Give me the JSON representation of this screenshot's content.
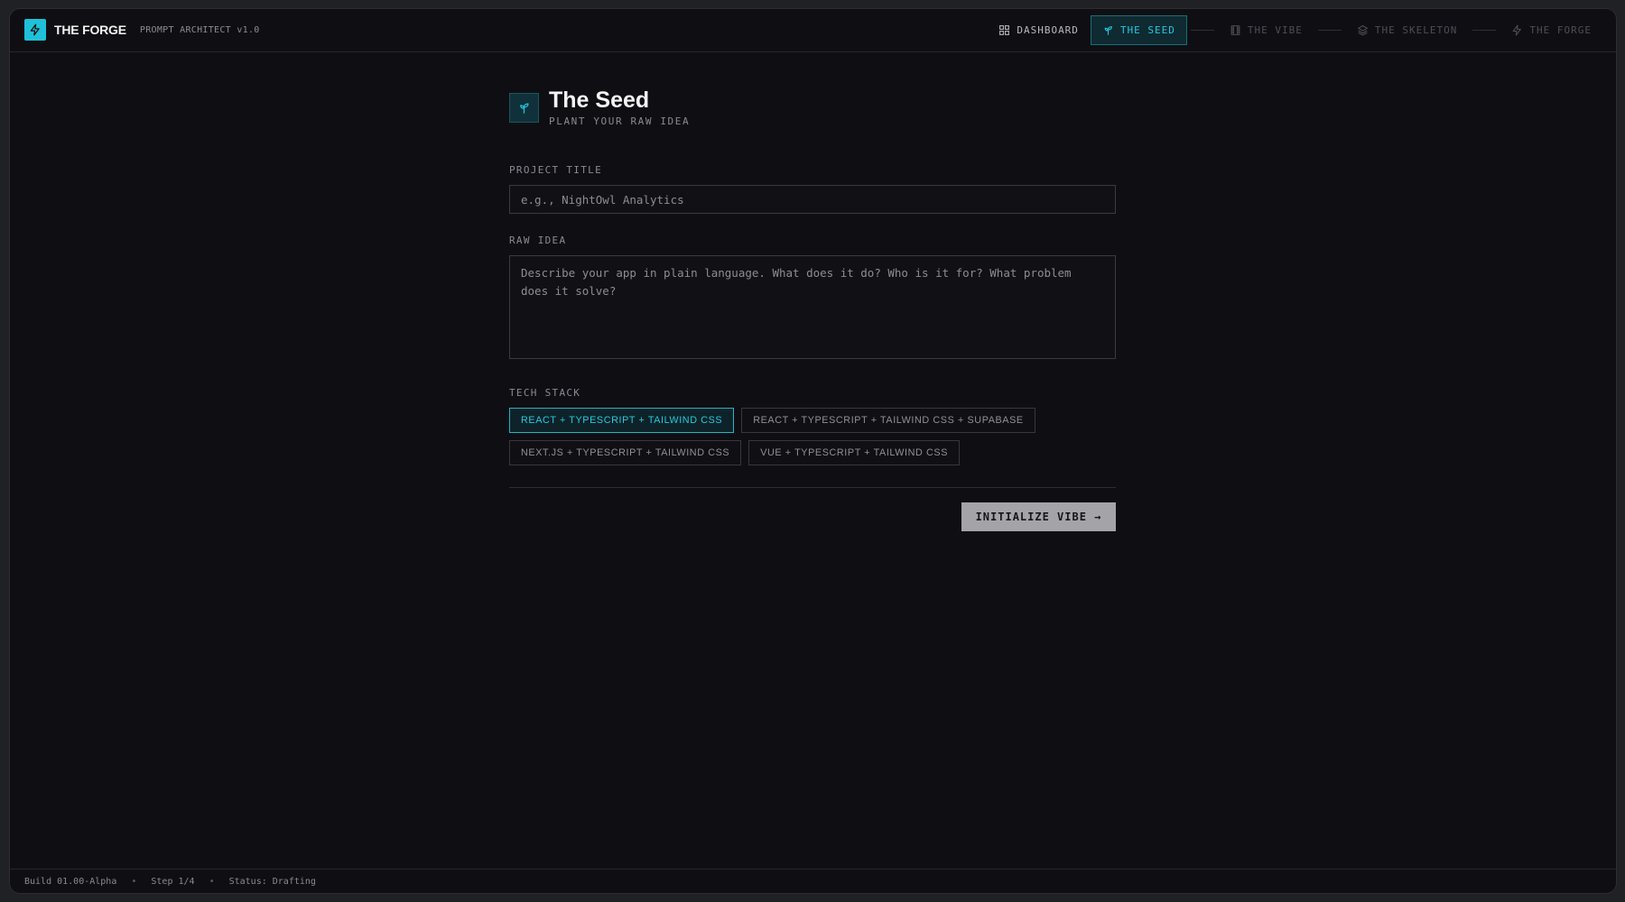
{
  "brand": {
    "name": "THE FORGE",
    "subtitle": "PROMPT ARCHITECT v1.0",
    "accent": "#1fc1d9"
  },
  "nav": {
    "dashboard": "DASHBOARD",
    "steps": [
      {
        "label": "THE SEED",
        "icon": "sprout-icon",
        "active": true
      },
      {
        "label": "THE VIBE",
        "icon": "film-icon",
        "active": false
      },
      {
        "label": "THE SKELETON",
        "icon": "layers-icon",
        "active": false
      },
      {
        "label": "THE FORGE",
        "icon": "bolt-icon",
        "active": false
      }
    ]
  },
  "page": {
    "title": "The Seed",
    "subtitle": "PLANT YOUR RAW IDEA"
  },
  "form": {
    "project_title_label": "PROJECT TITLE",
    "project_title_placeholder": "e.g., NightOwl Analytics",
    "project_title_value": "",
    "raw_idea_label": "RAW IDEA",
    "raw_idea_placeholder": "Describe your app in plain language. What does it do? Who is it for? What problem does it solve?",
    "raw_idea_value": "",
    "tech_stack_label": "TECH STACK",
    "tech_stack_options": [
      "REACT + TYPESCRIPT + TAILWIND CSS",
      "REACT + TYPESCRIPT + TAILWIND CSS + SUPABASE",
      "NEXT.JS + TYPESCRIPT + TAILWIND CSS",
      "VUE + TYPESCRIPT + TAILWIND CSS"
    ],
    "tech_stack_selected": "REACT + TYPESCRIPT + TAILWIND CSS",
    "submit_label": "INITIALIZE VIBE →"
  },
  "footer": {
    "build": "Build 01.00-Alpha",
    "step": "Step 1/4",
    "status": "Status: Drafting"
  }
}
